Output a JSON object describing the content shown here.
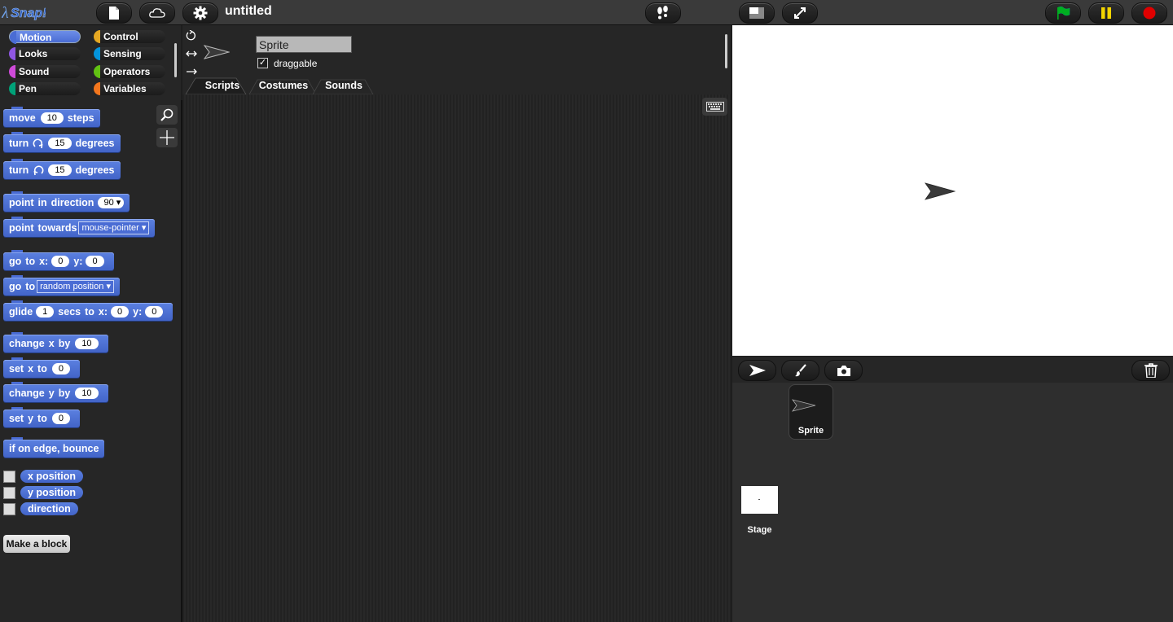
{
  "topbar": {
    "logo_text": "Snap!",
    "project_title": "untitled"
  },
  "categories": [
    "Motion",
    "Control",
    "Looks",
    "Sensing",
    "Sound",
    "Operators",
    "Pen",
    "Variables"
  ],
  "palette": {
    "move": {
      "w1": "move",
      "v": "10",
      "w2": "steps"
    },
    "turn_cw": {
      "w1": "turn",
      "v": "15",
      "w2": "degrees"
    },
    "turn_ccw": {
      "w1": "turn",
      "v": "15",
      "w2": "degrees"
    },
    "point_dir": {
      "w1": "point",
      "w2": "in",
      "w3": "direction",
      "v": "90"
    },
    "point_towards": {
      "w1": "point",
      "w2": "towards",
      "v": "mouse-pointer"
    },
    "goto_xy": {
      "w1": "go",
      "w2": "to",
      "w3": "x:",
      "v1": "0",
      "w4": "y:",
      "v2": "0"
    },
    "goto": {
      "w1": "go",
      "w2": "to",
      "v": "random position"
    },
    "glide": {
      "w1": "glide",
      "v1": "1",
      "w2": "secs",
      "w3": "to",
      "w4": "x:",
      "v2": "0",
      "w5": "y:",
      "v3": "0"
    },
    "change_x": {
      "w1": "change",
      "w2": "x",
      "w3": "by",
      "v": "10"
    },
    "set_x": {
      "w1": "set",
      "w2": "x",
      "w3": "to",
      "v": "0"
    },
    "change_y": {
      "w1": "change",
      "w2": "y",
      "w3": "by",
      "v": "10"
    },
    "set_y": {
      "w1": "set",
      "w2": "y",
      "w3": "to",
      "v": "0"
    },
    "bounce": "if on edge, bounce",
    "rep_x": "x position",
    "rep_y": "y position",
    "rep_dir": "direction",
    "make_block": "Make a block"
  },
  "sprite": {
    "name": "Sprite",
    "draggable_label": "draggable"
  },
  "tabs": [
    "Scripts",
    "Costumes",
    "Sounds"
  ],
  "corral": {
    "sprite_label": "Sprite",
    "stage_label": "Stage"
  },
  "colors": {
    "motion": "#4a6cd4",
    "looks": "#8f56e3",
    "sound": "#cf4ad9",
    "pen": "#00a178",
    "control": "#e6a822",
    "sensing": "#0494dc",
    "operators": "#62c213",
    "variables": "#f3761d"
  }
}
